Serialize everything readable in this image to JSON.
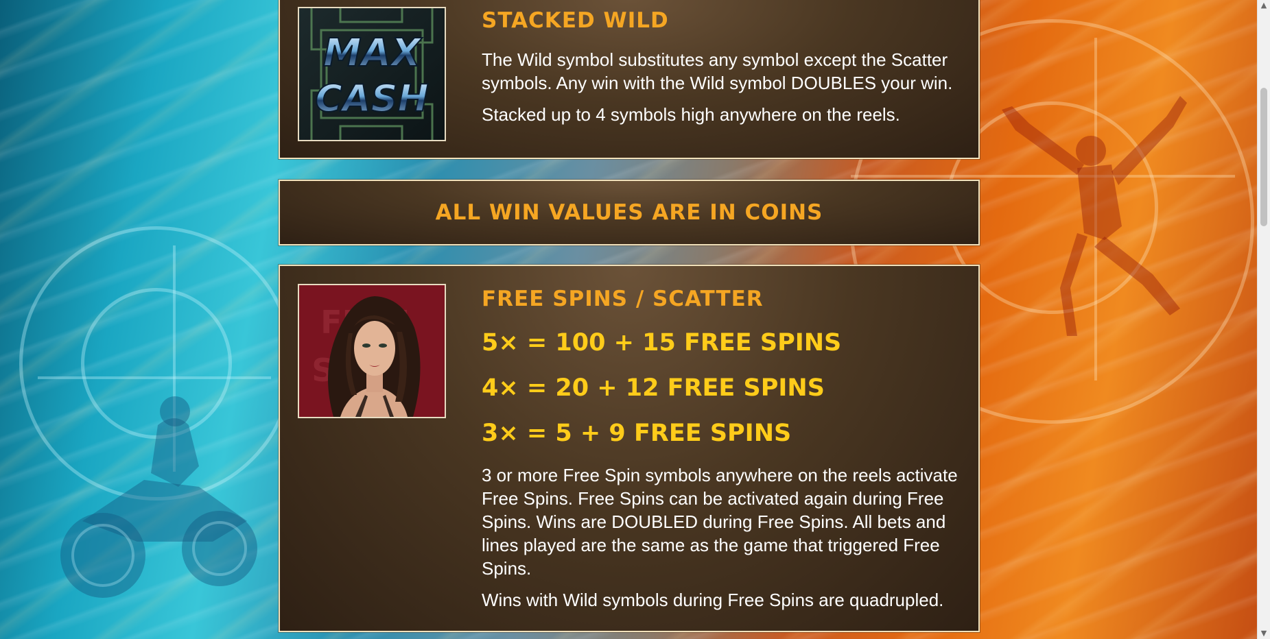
{
  "stacked_wild": {
    "heading": "STACKED WILD",
    "symbol_icon": "max-cash-wild-symbol",
    "paragraph_1": "The Wild symbol substitutes any symbol except the Scatter symbols. Any win with the Wild symbol DOUBLES your win.",
    "paragraph_2": "Stacked up to 4 symbols high anywhere on the reels.",
    "logo_line_1": "MAX",
    "logo_line_2": "CASH"
  },
  "coins_notice": {
    "title": "ALL WIN VALUES ARE IN COINS"
  },
  "free_spins": {
    "heading": "FREE SPINS / SCATTER",
    "symbol_icon": "woman-portrait-scatter-symbol",
    "symbol_background_text_1": "FREE",
    "symbol_background_text_2": "SPINS",
    "pays": [
      "5× = 100 + 15 FREE SPINS",
      "4× = 20 + 12 FREE SPINS",
      "3× = 5 + 9 FREE SPINS"
    ],
    "paragraph_1": "3 or more Free Spin symbols anywhere on the reels activate Free Spins. Free Spins can be activated again during Free Spins. Wins are DOUBLED during Free Spins. All bets and lines played are the same as the game that triggered Free Spins.",
    "paragraph_2": "Wins with Wild symbols during Free Spins are quadrupled."
  },
  "scrollbar": {
    "up_arrow_icon": "chevron-up-icon",
    "down_arrow_icon": "chevron-down-icon"
  },
  "colors": {
    "heading_orange": "#f5a623",
    "payline_yellow": "#ffcc1a",
    "panel_border": "#f2e2bc",
    "panel_brown": "#4a3722"
  }
}
